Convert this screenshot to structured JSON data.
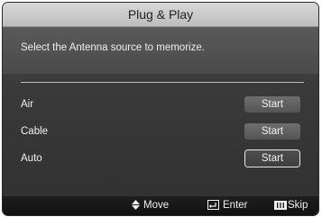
{
  "dialog": {
    "title": "Plug & Play",
    "instruction": "Select the Antenna source to memorize."
  },
  "options": [
    {
      "label": "Air",
      "button": "Start",
      "selected": false
    },
    {
      "label": "Cable",
      "button": "Start",
      "selected": false
    },
    {
      "label": "Auto",
      "button": "Start",
      "selected": true
    }
  ],
  "footer": {
    "move": {
      "icon": "up-down-arrow-icon",
      "label": "Move"
    },
    "enter": {
      "icon": "enter-icon",
      "label": "Enter"
    },
    "skip": {
      "icon": "tools-button-icon",
      "label": "Skip"
    }
  }
}
